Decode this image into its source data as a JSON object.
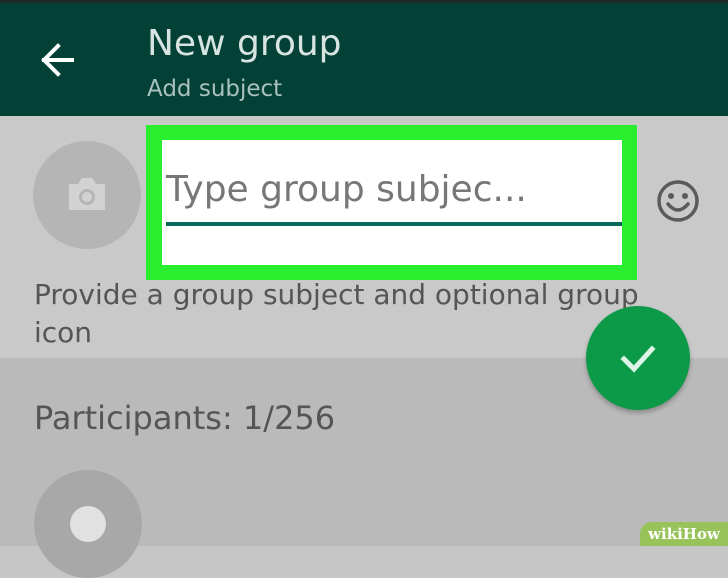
{
  "header": {
    "title": "New group",
    "subtitle": "Add subject",
    "back_icon": "arrow-left-icon",
    "background": "#034035"
  },
  "subject_input": {
    "value": "Type group subjec...",
    "highlight_color": "#28ee2d",
    "underline_color": "#046b5c"
  },
  "group_icon": {
    "icon": "camera-icon"
  },
  "emoji_button": {
    "icon": "smiley-icon"
  },
  "helper_text": "Provide a group subject and optional group icon",
  "confirm_button": {
    "icon": "checkmark-icon",
    "color": "#0d9a48"
  },
  "participants": {
    "label": "Participants: 1/256"
  },
  "watermark": {
    "text": "wikiHow"
  }
}
